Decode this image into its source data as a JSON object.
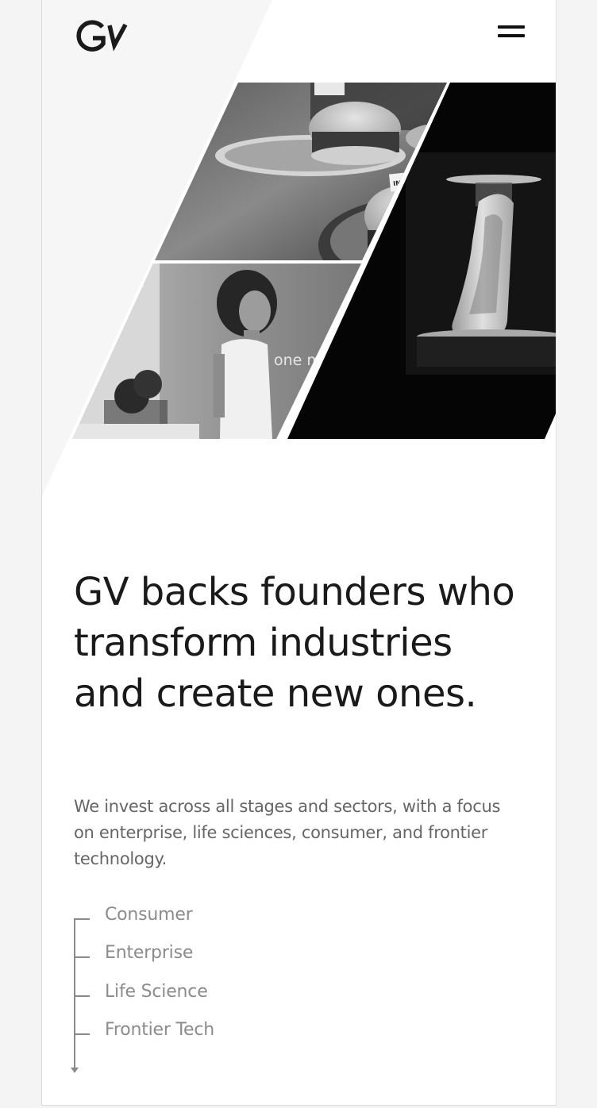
{
  "header": {
    "logo_text": "GV",
    "menu_icon": "hamburger-menu-icon"
  },
  "hero": {
    "images": [
      {
        "subject": "burger-photo",
        "sign_text": "IMPOSSIBLE"
      },
      {
        "subject": "woman-photo",
        "sign_text": "one m"
      },
      {
        "subject": "3d-printed-shoe-photo"
      }
    ]
  },
  "main": {
    "headline": "GV backs founders who transform industries and create new ones.",
    "subhead": "We invest across all stages and sectors, with a focus on enterprise, life sciences, consumer, and frontier technology."
  },
  "sectors": {
    "items": [
      {
        "label": "Consumer"
      },
      {
        "label": "Enterprise"
      },
      {
        "label": "Life Science"
      },
      {
        "label": "Frontier Tech"
      }
    ]
  },
  "colors": {
    "text_primary": "#1a1a1a",
    "text_secondary": "#666666",
    "text_muted": "#8c8c8c",
    "background": "#ffffff"
  }
}
